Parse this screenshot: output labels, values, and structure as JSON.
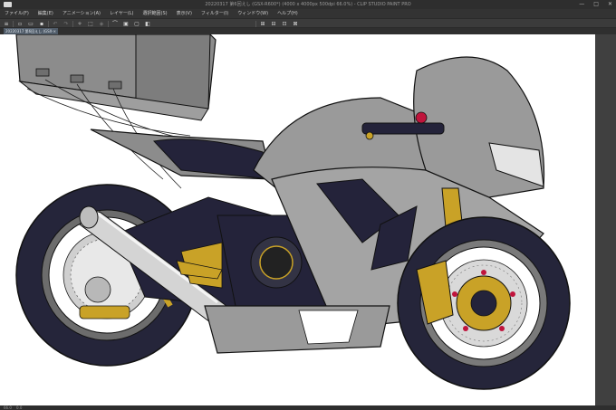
{
  "app": {
    "title": "20220317 第6回えし (GSX-R600*) (4000 x 4000px 500dpi 66.0%) - CLIP STUDIO PAINT PRO"
  },
  "window_controls": {
    "minimize": "—",
    "maximize": "□",
    "close": "✕"
  },
  "menu": [
    "ファイル(F)",
    "編集(E)",
    "アニメーション(A)",
    "レイヤー(L)",
    "選択範囲(S)",
    "表示(V)",
    "フィルター(I)",
    "ウィンドウ(W)",
    "ヘルプ(H)"
  ],
  "toolbar_icons": [
    "menu-icon",
    "new-icon",
    "open-icon",
    "save-icon",
    "undo-icon",
    "redo-icon",
    "clear-icon",
    "transform-icon",
    "fill-icon",
    "lasso-icon",
    "select-all-icon",
    "deselect-icon",
    "invert-icon",
    "snap-ruler-icon",
    "snap-grid-icon",
    "snap-special-icon"
  ],
  "document_tab": {
    "label": "20220317 第6回えし (GSX-R600*)",
    "close": "×"
  },
  "status": {
    "zoom": "66.0",
    "coords": "0.0"
  },
  "colors": {
    "body_gray": "#8c8c8c",
    "body_gray_light": "#a4a4a4",
    "tank_gray": "#9a9a9a",
    "dark_navy": "#24233a",
    "tire": "#25253a",
    "gold": "#c9a227",
    "red": "#c0143c",
    "canvas_bg": "#ffffff",
    "ui_dark": "#333333"
  }
}
